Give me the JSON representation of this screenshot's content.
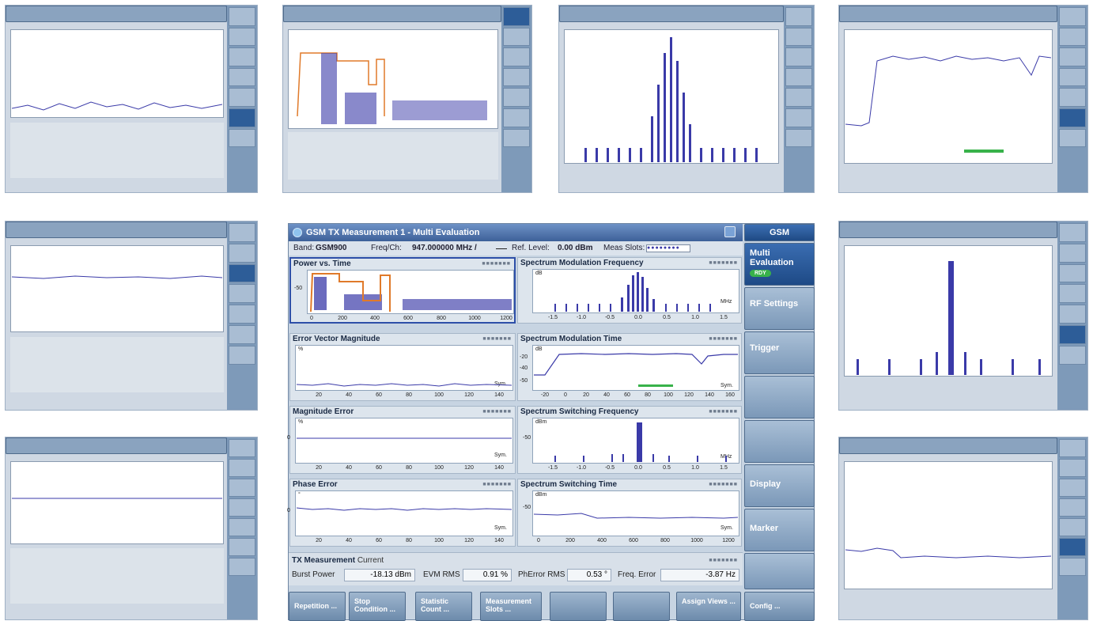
{
  "window": {
    "title": "GSM TX Measurement 1 - Multi Evaluation"
  },
  "header": {
    "band_label": "Band:",
    "band_value": "GSM900",
    "freq_label": "Freq/Ch:",
    "freq_value": "947.000000 MHz /",
    "ref_label": "Ref. Level:",
    "ref_value": "0.00 dBm",
    "slots_label": "Meas Slots:"
  },
  "panels": {
    "pvt": {
      "title": "Power vs. Time",
      "y": "-50",
      "x": [
        "0",
        "200",
        "400",
        "600",
        "800",
        "1000",
        "1200"
      ]
    },
    "smf": {
      "title": "Spectrum Modulation Frequency",
      "y": "dB",
      "unit": "MHz",
      "x": [
        "-1.5",
        "-1.0",
        "-0.5",
        "0.0",
        "0.5",
        "1.0",
        "1.5"
      ]
    },
    "evm": {
      "title": "Error Vector Magnitude",
      "y": "%",
      "unit": "Sym.",
      "x": [
        "20",
        "40",
        "60",
        "80",
        "100",
        "120",
        "140"
      ]
    },
    "smt": {
      "title": "Spectrum Modulation Time",
      "y": "dB",
      "yticks": [
        "-20",
        "-30",
        "-40",
        "-50"
      ],
      "unit": "Sym.",
      "x": [
        "-20",
        "0",
        "20",
        "40",
        "60",
        "80",
        "100",
        "120",
        "140",
        "160"
      ]
    },
    "mag": {
      "title": "Magnitude Error",
      "y": "%",
      "y0": "0",
      "unit": "Sym.",
      "x": [
        "20",
        "40",
        "60",
        "80",
        "100",
        "120",
        "140"
      ]
    },
    "ssf": {
      "title": "Spectrum Switching Frequency",
      "y": "dBm",
      "y1": "-50",
      "unit": "MHz",
      "x": [
        "-1.5",
        "-1.0",
        "-0.5",
        "0.0",
        "0.5",
        "1.0",
        "1.5"
      ]
    },
    "phe": {
      "title": "Phase Error",
      "y": "°",
      "y0": "0",
      "unit": "Sym.",
      "x": [
        "20",
        "40",
        "60",
        "80",
        "100",
        "120",
        "140"
      ]
    },
    "sst": {
      "title": "Spectrum Switching Time",
      "y": "dBm",
      "y1": "-50",
      "unit": "Sym.",
      "x": [
        "0",
        "200",
        "400",
        "600",
        "800",
        "1000",
        "1200"
      ]
    }
  },
  "results": {
    "title": "TX Measurement",
    "mode": "Current",
    "burst_label": "Burst Power",
    "burst_value": "-18.13 dBm",
    "evm_label": "EVM RMS",
    "evm_value": "0.91 %",
    "ph_label": "PhError RMS",
    "ph_value": "0.53 °",
    "freq_label": "Freq. Error",
    "freq_value": "-3.87 Hz"
  },
  "softkeys": [
    "Repetition ...",
    "Stop Condition ...",
    "Statistic Count ...",
    "Measurement Slots ...",
    "",
    "",
    "Assign Views ...",
    "Config ..."
  ],
  "rightbar": {
    "header": "GSM",
    "multi": "Multi Evaluation",
    "rdy": "RDY",
    "rf": "RF Settings",
    "trigger": "Trigger",
    "display": "Display",
    "marker": "Marker"
  },
  "colors": {
    "accent": "#2d4fa8",
    "trace": "#3a3aa8",
    "mask": "#e07a2a",
    "ok": "#38b24a"
  }
}
